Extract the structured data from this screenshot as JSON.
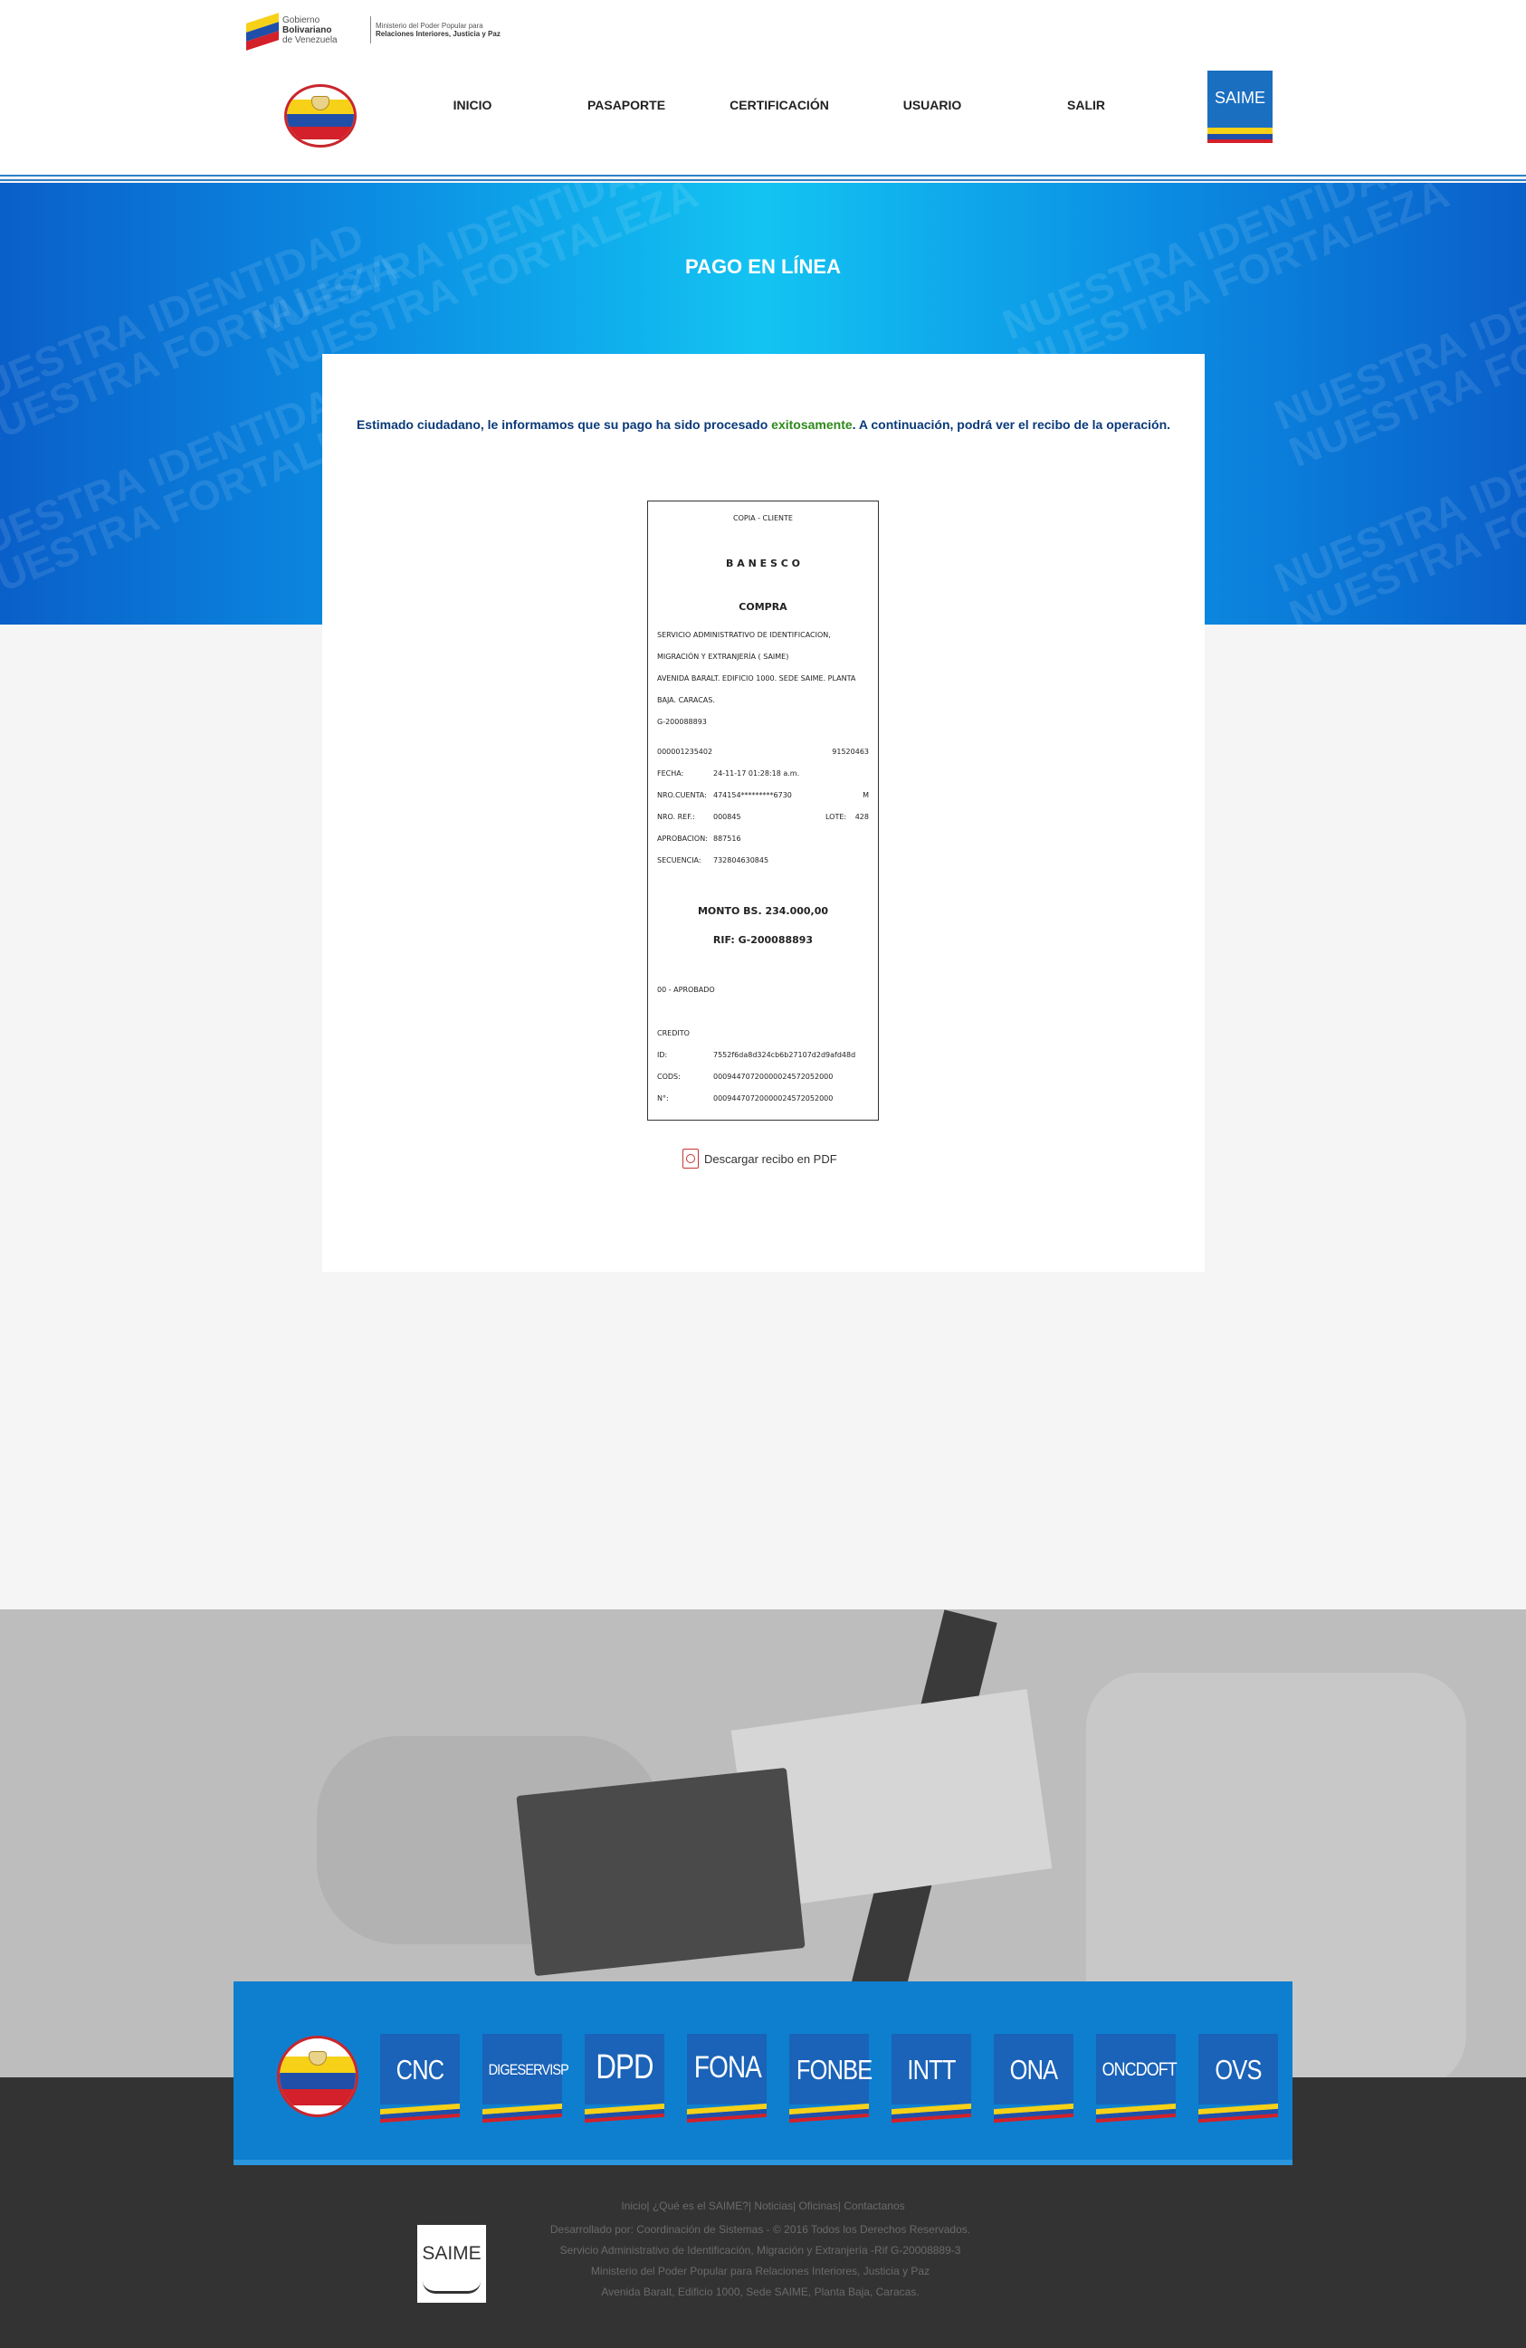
{
  "gov": {
    "line1a": "Gobierno",
    "line1b": "Bolivariano",
    "line2": "de Venezuela",
    "ministry1": "Ministerio del Poder Popular para",
    "ministry2": "Relaciones Interiores, Justicia y Paz"
  },
  "nav": {
    "items": [
      "INICIO",
      "PASAPORTE",
      "CERTIFICACIÓN",
      "USUARIO",
      "SALIR"
    ]
  },
  "brand": {
    "logo_text": "SAIME"
  },
  "hero": {
    "title": "PAGO EN LÍNEA",
    "watermark": [
      "NUESTRA IDENTIDAD",
      "NUESTRA FORTALEZA"
    ]
  },
  "message": {
    "before": "Estimado ciudadano, le informamos que su pago ha sido procesado ",
    "highlight": "exitosamente",
    "after": ". A continuación, podrá ver el recibo de la operación."
  },
  "receipt": {
    "copy": "COPIA - CLIENTE",
    "bank": "B A N E S C O",
    "type": "COMPRA",
    "merchant": [
      "SERVICIO ADMINISTRATIVO DE IDENTIFICACION,",
      "MIGRACIÓN Y EXTRANJERÍA ( SAIME)",
      "AVENIDA BARALT. EDIFICIO 1000. SEDE SAIME. PLANTA",
      "BAJA. CARACAS.",
      "G-200088893"
    ],
    "terminal": "000001235402",
    "affiliate": "91520463",
    "fecha_label": "FECHA:",
    "fecha": "24-11-17 01:28:18 a.m.",
    "cuenta_label": "NRO.CUENTA:",
    "cuenta": "474154*********6730",
    "cuenta_flag": "M",
    "ref_label": "NRO. REF.:",
    "ref": "000845",
    "lote_label": "LOTE:",
    "lote": "428",
    "aprob_label": "APROBACION:",
    "aprob": "887516",
    "sec_label": "SECUENCIA:",
    "sec": "732804630845",
    "monto": "MONTO BS. 234.000,00",
    "rif": "RIF: G-200088893",
    "status": "00 -  APROBADO",
    "credito": "CREDITO",
    "id_label": "ID:",
    "id": "7552f6da8d324cb6b27107d2d9afd48d",
    "cods_label": "CODS:",
    "cods": "00094470720000024572052000",
    "n_label": "N°:",
    "n": "00094470720000024572052000"
  },
  "download": {
    "label": "Descargar recibo en PDF"
  },
  "institutions": [
    "CNC",
    "DIGESERVISP",
    "DPD",
    "FONA",
    "FONBE",
    "INTT",
    "ONA",
    "ONCDOFT",
    "OVS"
  ],
  "footer": {
    "links": "Inicio| ¿Qué es el SAIME?| Noticias| Oficinas| Contactanos",
    "lines": [
      "Desarrollado por: Coordinación de Sistemas - © 2016 Todos los Derechos Reservados.",
      "Servicio Administrativo de Identificación, Migración y Extranjería -Rif G-20008889-3",
      "Ministerio del Poder Popular para Relaciones Interiores, Justicia y Paz",
      "Avenida Baralt, Edificio 1000, Sede SAIME, Planta Baja, Caracas."
    ],
    "logo_text": "SAIME"
  }
}
